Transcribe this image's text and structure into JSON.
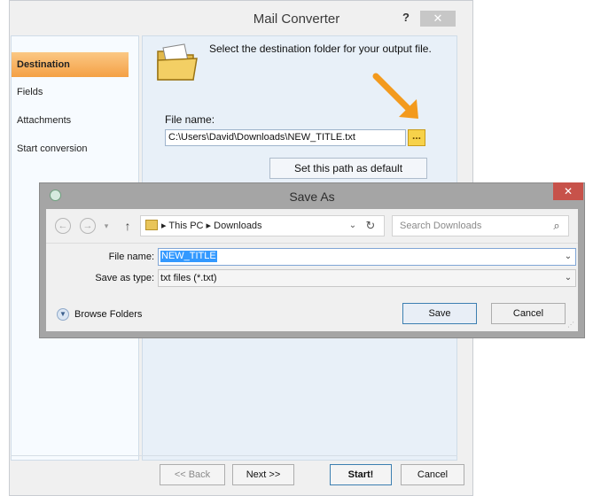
{
  "main_window": {
    "title": "Mail Converter",
    "help_label": "?",
    "close_label": "✕",
    "sidebar": {
      "items": [
        {
          "label": "Destination",
          "active": true
        },
        {
          "label": "Fields"
        },
        {
          "label": "Attachments"
        },
        {
          "label": "Start conversion"
        }
      ]
    },
    "header_text": "Select the destination folder for your output file.",
    "file_name_label": "File name:",
    "file_name_value": "C:\\Users\\David\\Downloads\\NEW_TITLE.txt",
    "browse_label": "...",
    "set_default_label": "Set this path as default",
    "footer": {
      "back_label": "<< Back",
      "next_label": "Next >>",
      "start_label": "Start!",
      "cancel_label": "Cancel"
    }
  },
  "save_as_dialog": {
    "title": "Save As",
    "close_label": "✕",
    "nav": {
      "back_glyph": "←",
      "forward_glyph": "→",
      "recent_glyph": "▾",
      "up_glyph": "↑"
    },
    "address": {
      "path": "▸ This PC ▸ Downloads",
      "dropdown_glyph": "⌄",
      "refresh_glyph": "↻"
    },
    "search": {
      "placeholder": "Search Downloads",
      "icon_glyph": "⌕"
    },
    "file_name_label": "File name:",
    "file_name_value": "NEW_TITLE",
    "save_as_type_label": "Save as type:",
    "save_as_type_value": "txt files (*.txt)",
    "dropdown_glyph": "⌄",
    "browse_folders_label": "Browse Folders",
    "save_label": "Save",
    "cancel_label": "Cancel"
  },
  "colors": {
    "accent_orange": "#f6ad53",
    "arrow_orange": "#f39a1d",
    "selection_blue": "#3399ff",
    "dialog_close_red": "#c7524a"
  }
}
